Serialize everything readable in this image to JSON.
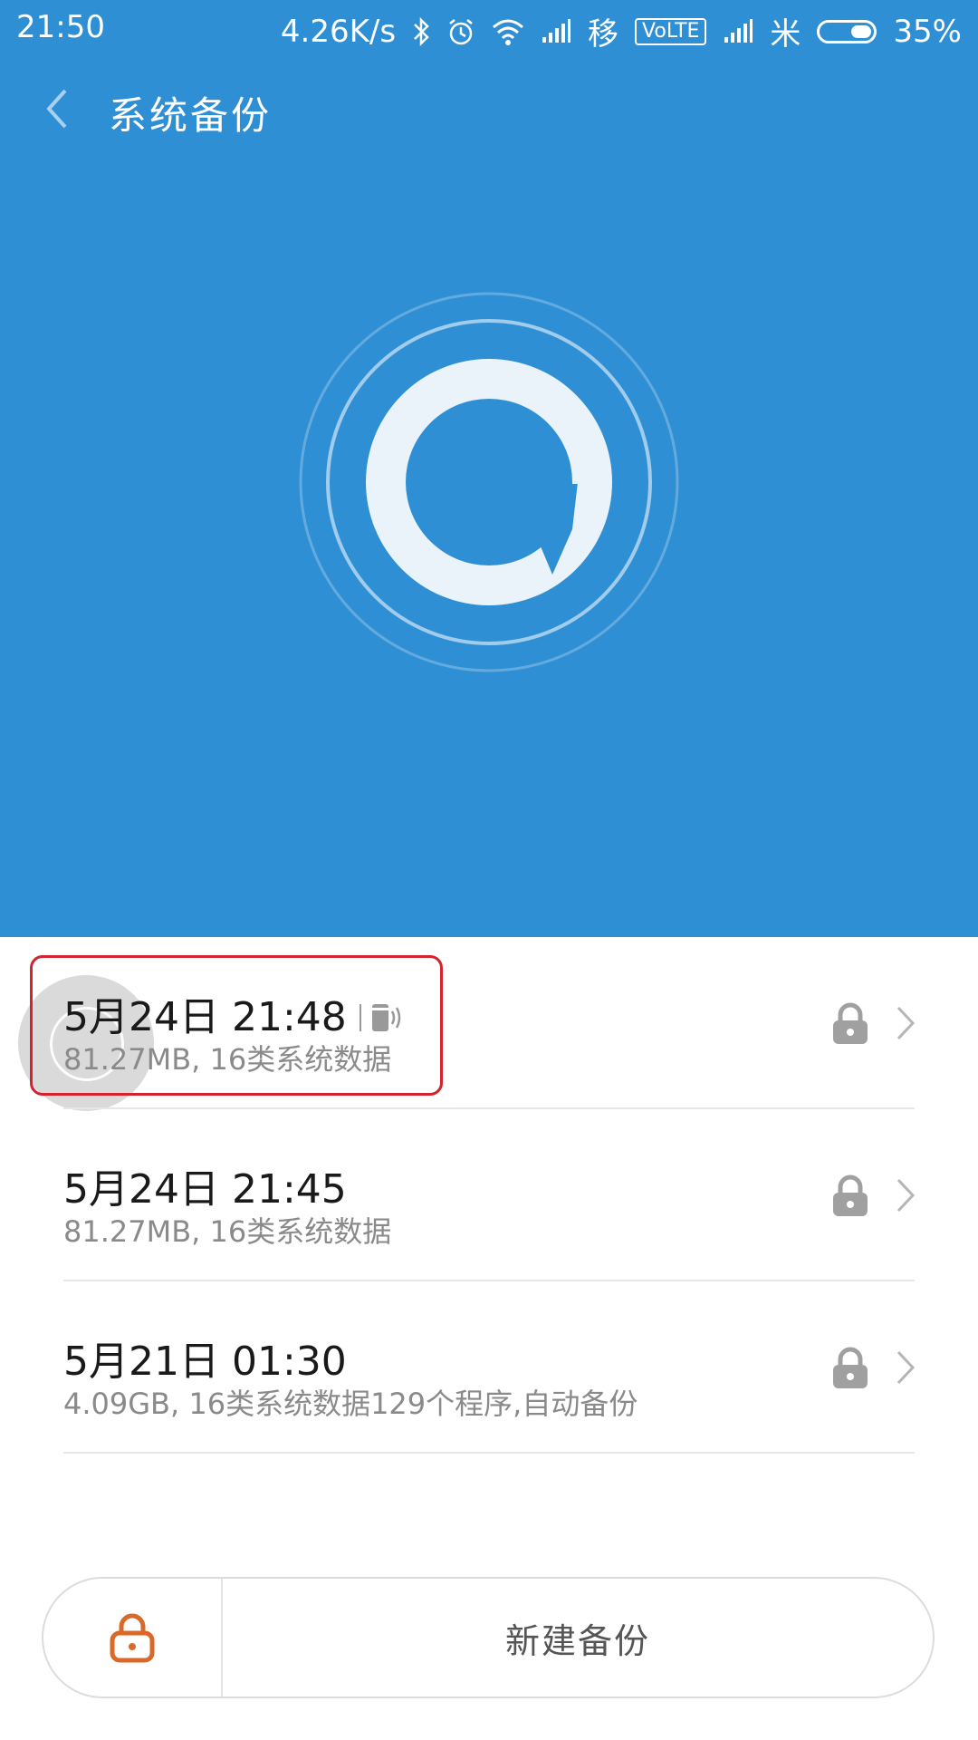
{
  "status_bar": {
    "time": "21:50",
    "net_speed": "4.26K/s",
    "carrier": "移",
    "volte": "VoLTE",
    "extra": "米",
    "battery": "35%"
  },
  "header": {
    "title": "系统备份"
  },
  "colors": {
    "hero_bg": "#2f8fd4",
    "accent_orange": "#d9692b",
    "highlight": "#d2232e"
  },
  "backups": [
    {
      "title": "5月24日 21:48",
      "subtitle": "81.27MB, 16类系统数据"
    },
    {
      "title": "5月24日 21:45",
      "subtitle": "81.27MB, 16类系统数据"
    },
    {
      "title": "5月21日 01:30",
      "subtitle": "4.09GB, 16类系统数据129个程序,自动备份"
    }
  ],
  "bottom": {
    "new_backup_label": "新建备份"
  }
}
